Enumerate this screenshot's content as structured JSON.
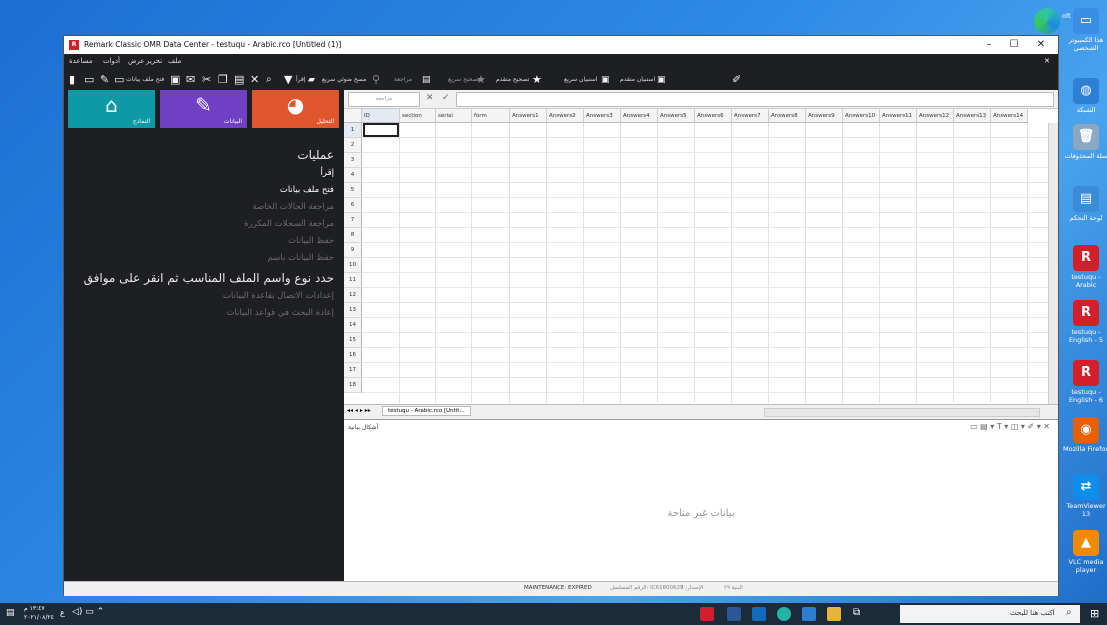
{
  "window": {
    "title": "Remark Classic OMR Data Center - testuqu - Arabic.rco [Untitled (1)]",
    "minimize": "–",
    "maximize": "☐",
    "close": "✕",
    "inner_close": "✕"
  },
  "menu": [
    "ملف",
    "تحرير",
    "عرض",
    "أدوات",
    "مساعدة"
  ],
  "toolbar": {
    "open_data": "فتح ملف بيانات",
    "read": "إقرأ",
    "quick_scan": "مسح ضوئي سريع",
    "review": "مراجعة",
    "quick_grade": "تصحيح سريع",
    "advanced_grade": "تصحيح متقدم",
    "quick_survey": "استبيان سريع",
    "advanced_survey": "استبيان متقدم"
  },
  "tiles": {
    "templates": "النماذج",
    "data": "البيانات",
    "analysis": "التحليل"
  },
  "operations": {
    "heading": "عمليات",
    "items": [
      {
        "label": "إقرأ",
        "enabled": true
      },
      {
        "label": "فتح ملف بيانات",
        "enabled": true
      },
      {
        "label": "مراجعة الحالات الخاصة",
        "enabled": false
      },
      {
        "label": "مراجعة السجلات المكررة",
        "enabled": false
      },
      {
        "label": "حفظ البيانات",
        "enabled": false
      },
      {
        "label": "حفظ البيانات باسم",
        "enabled": false
      }
    ],
    "heading2": "حدد نوع واسم الملف المناسب ثم انقر على موافق",
    "items2": [
      {
        "label": "إعدادات الاتصال بقاعدة البيانات",
        "enabled": false
      },
      {
        "label": "إعادة البحث في قواعد البيانات",
        "enabled": false
      }
    ]
  },
  "formula_bar": {
    "review_label": "مراجعة",
    "cancel": "✕",
    "confirm": "✓"
  },
  "grid": {
    "columns": [
      "ID",
      "section",
      "serial",
      "form",
      "Answers1",
      "Answers2",
      "Answers3",
      "Answers4",
      "Answers5",
      "Answers6",
      "Answers7",
      "Answers8",
      "Answers9",
      "Answers10",
      "Answers11",
      "Answers12",
      "Answers13",
      "Answers14"
    ],
    "rows": [
      "1",
      "2",
      "3",
      "4",
      "5",
      "6",
      "7",
      "8",
      "9",
      "10",
      "11",
      "12",
      "13",
      "14",
      "15",
      "16",
      "17",
      "18"
    ],
    "sheet_tab": "testuqu - Arabic.rco [Untit..."
  },
  "chart_panel": {
    "title": "أشكال بيانية",
    "empty_message": "بيانات غير متاحة"
  },
  "status": {
    "maintenance": "MAINTENANCE: EXPIRED",
    "serial": "الرقم المسلسل: IC61800629",
    "version": "الإصدار: 7 ",
    "extra": "البنية ٢٩"
  },
  "desktop_icons": [
    {
      "label": "هذا الكمبيوتر الشخصي",
      "color": "#3a8ee6",
      "glyph": "▭"
    },
    {
      "label": "الشبكة",
      "color": "#2e7fd6",
      "glyph": "◍"
    },
    {
      "label": "سلة المحذوفات",
      "color": "#8aa7c4",
      "glyph": "🗑"
    },
    {
      "label": "لوحة التحكم",
      "color": "#3b8bd7",
      "glyph": "▤"
    },
    {
      "label": "testuqu - Arabic",
      "color": "#d21f2a",
      "glyph": "R"
    },
    {
      "label": "testuqu - English - 5",
      "color": "#d21f2a",
      "glyph": "R"
    },
    {
      "label": "testuqu - English - 6",
      "color": "#d21f2a",
      "glyph": "R"
    },
    {
      "label": "Mozilla Firefox",
      "color": "#e66000",
      "glyph": "◉"
    },
    {
      "label": "TeamViewer 13",
      "color": "#0e8ee9",
      "glyph": "⇄"
    },
    {
      "label": "VLC media player",
      "color": "#f08a00",
      "glyph": "▲"
    }
  ],
  "taskbar": {
    "search_placeholder": "اكتب هنا للبحث",
    "time": "١٣:٤٧ م",
    "date": "٢٠٢١/٠٨/٢٤",
    "lang": "ع"
  },
  "partial_text": "oft"
}
